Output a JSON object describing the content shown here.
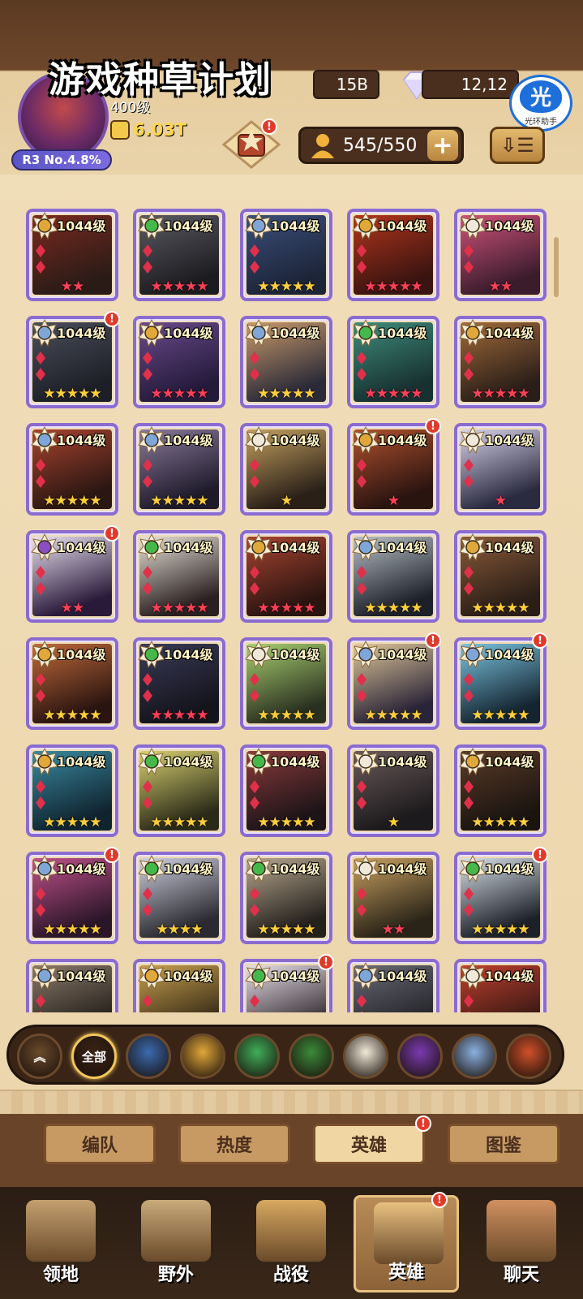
{
  "header": {
    "title": "游戏种草计划",
    "player_level": "400级",
    "power": "6.03T",
    "rank_badge": "R3 No.4.8%",
    "gold": "15B",
    "diamonds": "12,12",
    "badge_glyph": "光",
    "badge_caption": "光环助手",
    "hero_count": "545/550",
    "plus_label": "+",
    "sort_label": "⇩☰",
    "chest_alert": "!"
  },
  "heroes": [
    {
      "level": "1044级",
      "stars": "★★",
      "star_color": "red",
      "faction": "#e0a73a",
      "alert": false,
      "tint": [
        "#2b1b17",
        "#7a2a1f"
      ]
    },
    {
      "level": "1044级",
      "stars": "★★★★★",
      "star_color": "red",
      "faction": "#45b84b",
      "alert": false,
      "tint": [
        "#1c1c20",
        "#5a5a62"
      ]
    },
    {
      "level": "1044级",
      "stars": "★★★★★",
      "star_color": "gold",
      "faction": "#7fa6d8",
      "alert": false,
      "tint": [
        "#1c2438",
        "#3b4f7a"
      ]
    },
    {
      "level": "1044级",
      "stars": "★★★★★",
      "star_color": "red",
      "faction": "#e0a73a",
      "alert": false,
      "tint": [
        "#3a1410",
        "#b2351c"
      ]
    },
    {
      "level": "1044级",
      "stars": "★★",
      "star_color": "red",
      "faction": "#f0e8d8",
      "alert": false,
      "tint": [
        "#3a1c2c",
        "#d0527a"
      ]
    },
    {
      "level": "1044级",
      "stars": "★★★★★",
      "star_color": "gold",
      "faction": "#7fa6d8",
      "alert": true,
      "tint": [
        "#1d1f27",
        "#4a4e5a"
      ]
    },
    {
      "level": "1044级",
      "stars": "★★★★★",
      "star_color": "red",
      "faction": "#e0a73a",
      "alert": false,
      "tint": [
        "#241a3a",
        "#6a4a8c"
      ]
    },
    {
      "level": "1044级",
      "stars": "★★★★★",
      "star_color": "gold",
      "faction": "#7fa6d8",
      "alert": false,
      "tint": [
        "#2a2a38",
        "#c99a6a"
      ]
    },
    {
      "level": "1044级",
      "stars": "★★★★★",
      "star_color": "red",
      "faction": "#45b84b",
      "alert": false,
      "tint": [
        "#173030",
        "#3f8c7c"
      ]
    },
    {
      "level": "1044级",
      "stars": "★★★★★",
      "star_color": "red",
      "faction": "#e0a73a",
      "alert": false,
      "tint": [
        "#2a1e18",
        "#a06a3a"
      ]
    },
    {
      "level": "1044级",
      "stars": "★★★★★",
      "star_color": "gold",
      "faction": "#7fa6d8",
      "alert": false,
      "tint": [
        "#2a1612",
        "#a8432e"
      ]
    },
    {
      "level": "1044级",
      "stars": "★★★★★",
      "star_color": "gold",
      "faction": "#7fa6d8",
      "alert": false,
      "tint": [
        "#1e1a2a",
        "#8a7a9a"
      ]
    },
    {
      "level": "1044级",
      "stars": "★",
      "star_color": "gold",
      "faction": "#f0e8d8",
      "alert": false,
      "tint": [
        "#2a2018",
        "#c4a060"
      ]
    },
    {
      "level": "1044级",
      "stars": "★",
      "star_color": "red",
      "faction": "#e0a73a",
      "alert": true,
      "tint": [
        "#2a1410",
        "#b0502e"
      ]
    },
    {
      "level": "1044级",
      "stars": "★",
      "star_color": "red",
      "faction": "#f0e8d8",
      "alert": false,
      "tint": [
        "#2a2a40",
        "#d6d2ea"
      ]
    },
    {
      "level": "1044级",
      "stars": "★★",
      "star_color": "red",
      "faction": "#8a4ec2",
      "alert": true,
      "tint": [
        "#2a1a3a",
        "#e8e0f0"
      ]
    },
    {
      "level": "1044级",
      "stars": "★★★★★",
      "star_color": "red",
      "faction": "#45b84b",
      "alert": false,
      "tint": [
        "#2a2020",
        "#e8e2d8"
      ]
    },
    {
      "level": "1044级",
      "stars": "★★★★★",
      "star_color": "red",
      "faction": "#e0a73a",
      "alert": false,
      "tint": [
        "#2a1410",
        "#a84430"
      ]
    },
    {
      "level": "1044级",
      "stars": "★★★★★",
      "star_color": "gold",
      "faction": "#7fa6d8",
      "alert": false,
      "tint": [
        "#1c2028",
        "#b8c0c8"
      ]
    },
    {
      "level": "1044级",
      "stars": "★★★★★",
      "star_color": "gold",
      "faction": "#e0a73a",
      "alert": false,
      "tint": [
        "#2a1e16",
        "#8a5a3a"
      ]
    },
    {
      "level": "1044级",
      "stars": "★★★★★",
      "star_color": "gold",
      "faction": "#e0a73a",
      "alert": false,
      "tint": [
        "#2a1410",
        "#c06a3a"
      ]
    },
    {
      "level": "1044级",
      "stars": "★★★★★",
      "star_color": "red",
      "faction": "#45b84b",
      "alert": false,
      "tint": [
        "#14141c",
        "#3a3a58"
      ]
    },
    {
      "level": "1044级",
      "stars": "★★★★★",
      "star_color": "gold",
      "faction": "#f0e8d8",
      "alert": false,
      "tint": [
        "#2a3020",
        "#a8d070"
      ]
    },
    {
      "level": "1044级",
      "stars": "★★★★★",
      "star_color": "gold",
      "faction": "#7fa6d8",
      "alert": true,
      "tint": [
        "#2a2438",
        "#e0c89a"
      ]
    },
    {
      "level": "1044级",
      "stars": "★★★★★",
      "star_color": "gold",
      "faction": "#7fa6d8",
      "alert": true,
      "tint": [
        "#142430",
        "#7ac4e0"
      ]
    },
    {
      "level": "1044级",
      "stars": "★★★★★",
      "star_color": "gold",
      "faction": "#e0a73a",
      "alert": false,
      "tint": [
        "#102430",
        "#3a8aa0"
      ]
    },
    {
      "level": "1044级",
      "stars": "★★★★★",
      "star_color": "gold",
      "faction": "#45b84b",
      "alert": false,
      "tint": [
        "#2a2a18",
        "#d8d070"
      ]
    },
    {
      "level": "1044级",
      "stars": "★★★★★",
      "star_color": "gold",
      "faction": "#45b84b",
      "alert": false,
      "tint": [
        "#1c1418",
        "#8a3a3a"
      ]
    },
    {
      "level": "1044级",
      "stars": "★",
      "star_color": "gold",
      "faction": "#f0e8d8",
      "alert": false,
      "tint": [
        "#1c1a1c",
        "#6a5a5a"
      ]
    },
    {
      "level": "1044级",
      "stars": "★★★★★",
      "star_color": "gold",
      "faction": "#e0a73a",
      "alert": false,
      "tint": [
        "#1a1410",
        "#5a3a28"
      ]
    },
    {
      "level": "1044级",
      "stars": "★★★★★",
      "star_color": "gold",
      "faction": "#7fa6d8",
      "alert": true,
      "tint": [
        "#2a1628",
        "#c0508a"
      ]
    },
    {
      "level": "1044级",
      "stars": "★★★★",
      "star_color": "gold",
      "faction": "#45b84b",
      "alert": false,
      "tint": [
        "#2a2a30",
        "#d0d0e0"
      ]
    },
    {
      "level": "1044级",
      "stars": "★★★★★",
      "star_color": "gold",
      "faction": "#45b84b",
      "alert": false,
      "tint": [
        "#24201c",
        "#b8a890"
      ]
    },
    {
      "level": "1044级",
      "stars": "★★",
      "star_color": "red",
      "faction": "#f0e8d8",
      "alert": false,
      "tint": [
        "#2a2418",
        "#c8a060"
      ]
    },
    {
      "level": "1044级",
      "stars": "★★★★★",
      "star_color": "gold",
      "faction": "#45b84b",
      "alert": true,
      "tint": [
        "#1c2028",
        "#d8e0e8"
      ]
    },
    {
      "level": "1044级",
      "stars": "",
      "star_color": "gold",
      "faction": "#7fa6d8",
      "alert": false,
      "tint": [
        "#1c1814",
        "#8a7a6a"
      ]
    },
    {
      "level": "1044级",
      "stars": "",
      "star_color": "gold",
      "faction": "#e0a73a",
      "alert": false,
      "tint": [
        "#2a2010",
        "#c8a050"
      ]
    },
    {
      "level": "1044级",
      "stars": "",
      "star_color": "gold",
      "faction": "#45b84b",
      "alert": true,
      "tint": [
        "#2a2028",
        "#e8e0e8"
      ]
    },
    {
      "level": "1044级",
      "stars": "",
      "star_color": "gold",
      "faction": "#7fa6d8",
      "alert": false,
      "tint": [
        "#1c1c20",
        "#6a6a78"
      ]
    },
    {
      "level": "1044级",
      "stars": "",
      "star_color": "gold",
      "faction": "#f0e8d8",
      "alert": false,
      "tint": [
        "#2a1410",
        "#c0402e"
      ]
    }
  ],
  "filters": [
    {
      "name": "collapse",
      "label": "︽",
      "color": "#6b4a2c"
    },
    {
      "name": "all",
      "label": "全部",
      "color": "#3a2416",
      "selected": true
    },
    {
      "name": "lightbearer",
      "label": "",
      "color": "#3a6ab0"
    },
    {
      "name": "mauler",
      "label": "",
      "color": "#e0a73a"
    },
    {
      "name": "wilder",
      "label": "",
      "color": "#3fae5a"
    },
    {
      "name": "graveborn",
      "label": "",
      "color": "#3a8a3a"
    },
    {
      "name": "celestial",
      "label": "",
      "color": "#f0e8d8"
    },
    {
      "name": "hypogean",
      "label": "",
      "color": "#7a3ab0"
    },
    {
      "name": "dimensional",
      "label": "",
      "color": "#8ab0e0"
    },
    {
      "name": "dragon",
      "label": "",
      "color": "#d0502a"
    }
  ],
  "tabs": [
    {
      "label": "编队",
      "active": false,
      "alert": false
    },
    {
      "label": "热度",
      "active": false,
      "alert": false
    },
    {
      "label": "英雄",
      "active": true,
      "alert": true
    },
    {
      "label": "图鉴",
      "active": false,
      "alert": false
    }
  ],
  "nav": [
    {
      "label": "领地",
      "active": false,
      "alert": false,
      "icon": "castle-icon",
      "color": "#c4a070"
    },
    {
      "label": "野外",
      "active": false,
      "alert": false,
      "icon": "map-icon",
      "color": "#c8aa7a"
    },
    {
      "label": "战役",
      "active": false,
      "alert": false,
      "icon": "sword-icon",
      "color": "#d8a860"
    },
    {
      "label": "英雄",
      "active": true,
      "alert": true,
      "icon": "gauntlet-icon",
      "color": "#e8c080"
    },
    {
      "label": "聊天",
      "active": false,
      "alert": false,
      "icon": "chat-icon",
      "color": "#d09060"
    }
  ]
}
